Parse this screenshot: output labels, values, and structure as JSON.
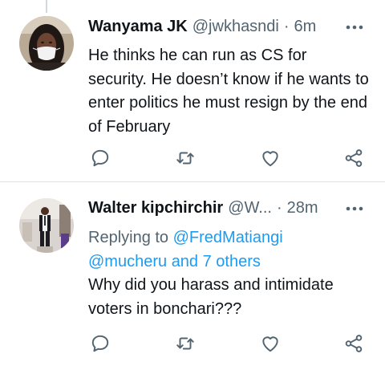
{
  "tweets": [
    {
      "display_name": "Wanyama JK",
      "handle": "@jwkhasndi",
      "separator": "·",
      "time": "6m",
      "text": "He thinks he can run as CS for security. He doesn’t know if he wants to enter politics he must resign by the end of February",
      "avatar_icon": "avatar-woman-with-face-mask"
    },
    {
      "display_name": "Walter kipchirchir",
      "handle": "@W...",
      "separator": "·",
      "time": "28m",
      "replying_to_prefix": "Replying to",
      "replying_to_user": "@FredMatiangi",
      "replying_to_user2": "@mucheru",
      "replying_to_others": "and 7 others",
      "text": "Why did you harass and intimidate voters in bonchari???",
      "avatar_icon": "avatar-man-standing-in-suit"
    }
  ],
  "icons": {
    "more": "more-options-icon",
    "reply": "reply-icon",
    "retweet": "retweet-icon",
    "like": "heart-icon",
    "share": "share-icon"
  },
  "colors": {
    "text_primary": "#0f1419",
    "text_secondary": "#536471",
    "link": "#1d9bf0",
    "divider": "#dfe3e6",
    "icon": "#536471"
  }
}
